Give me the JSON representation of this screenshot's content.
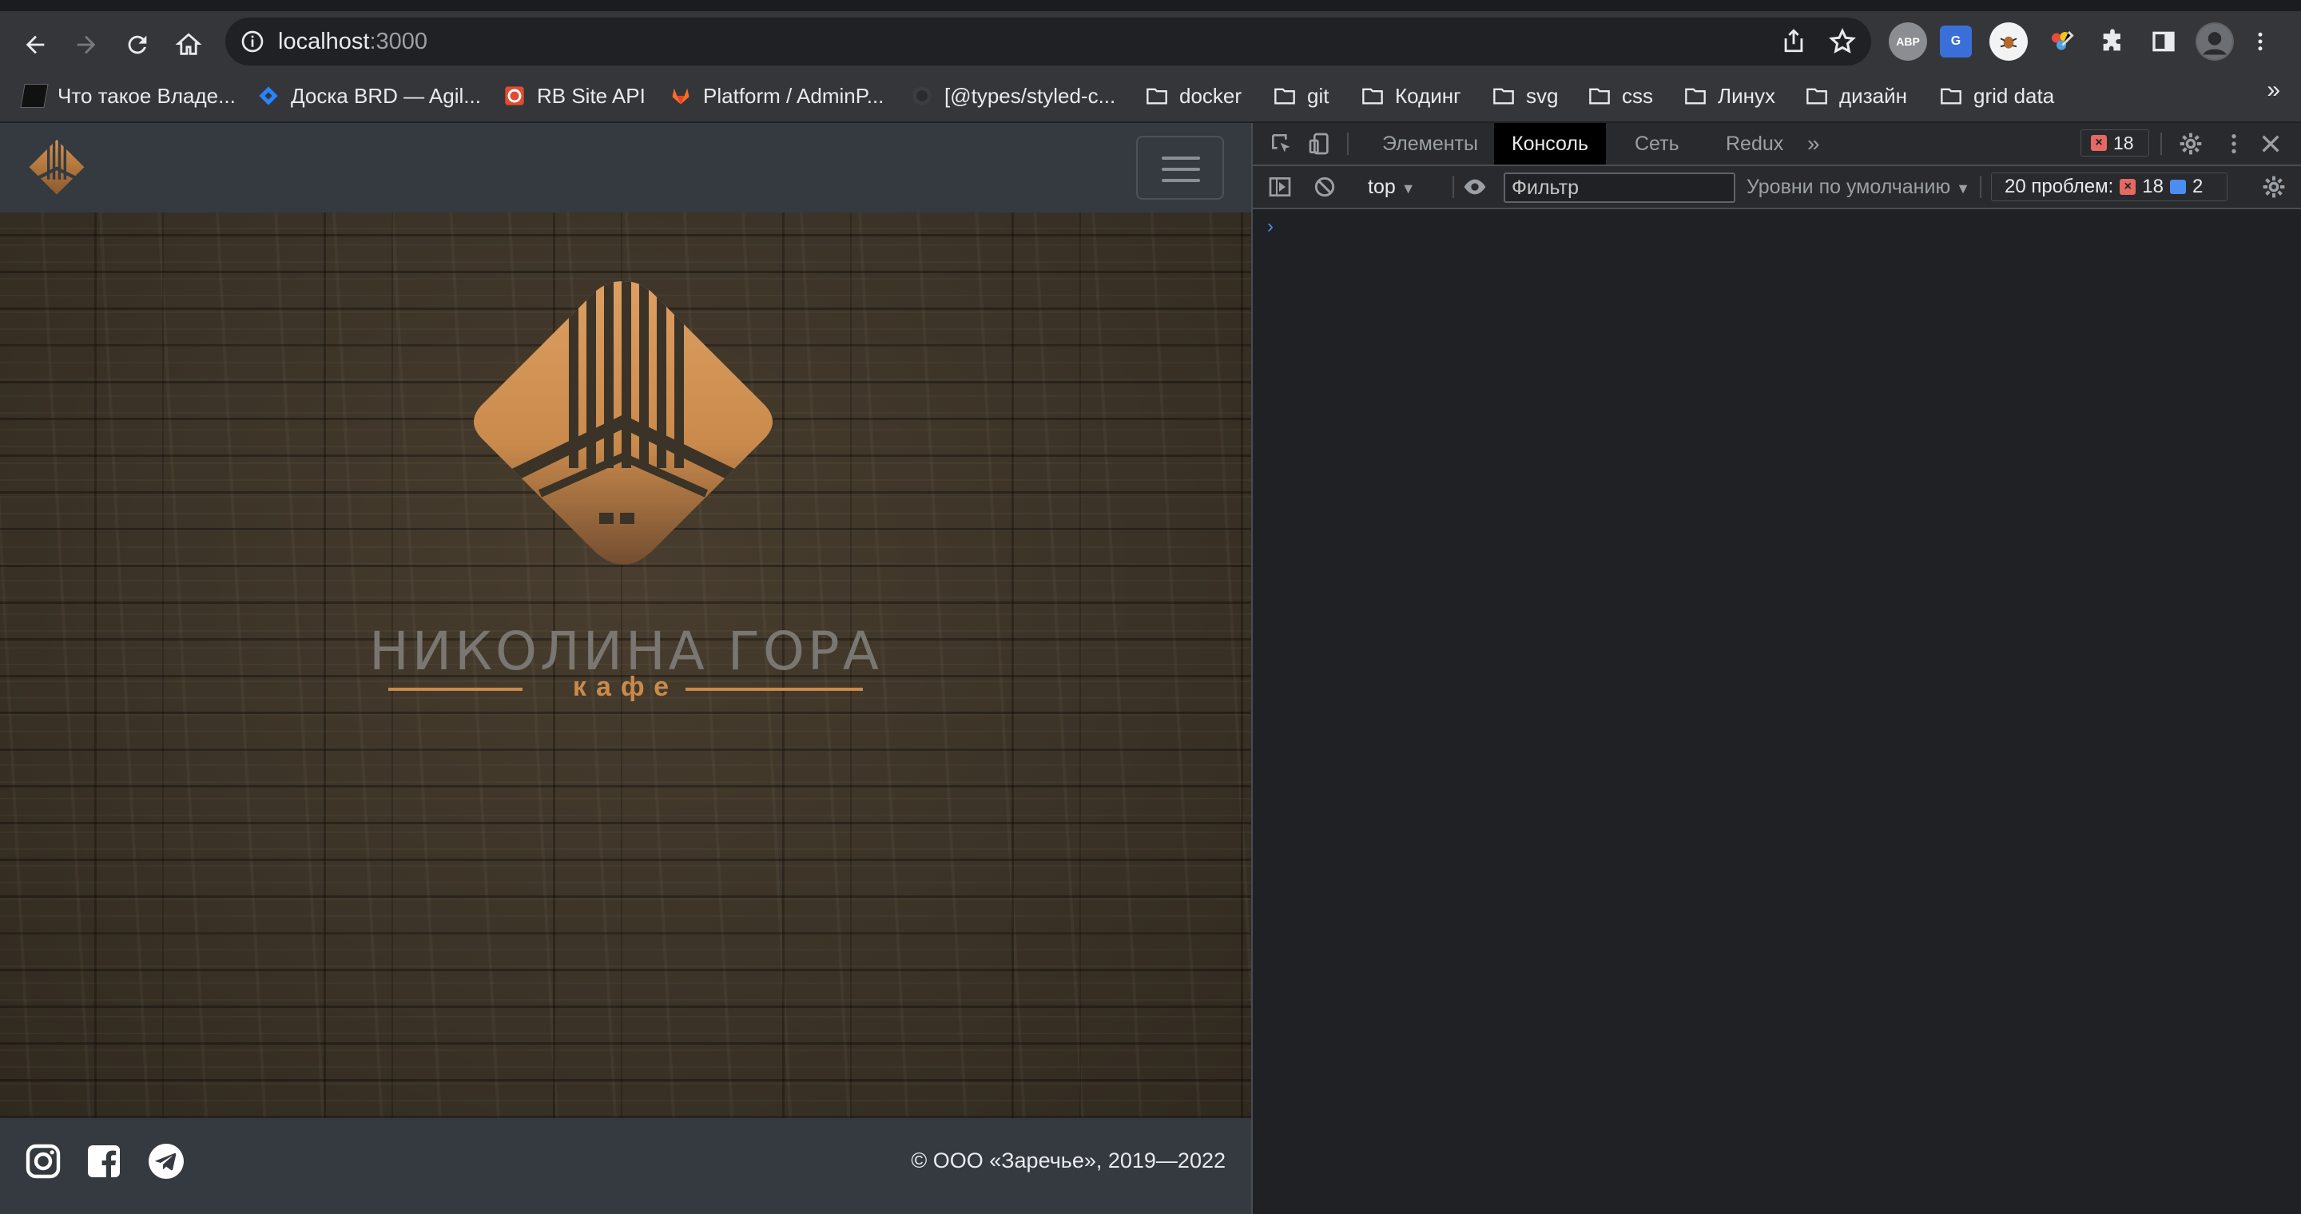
{
  "browser": {
    "url_host": "localhost",
    "url_port": ":3000",
    "extensions": [
      "ABP",
      "G"
    ],
    "bookmarks": [
      {
        "label": "Что такое Владе...",
        "icon": "dark-page-icon"
      },
      {
        "label": "Доска BRD — Agil...",
        "icon": "jira-icon"
      },
      {
        "label": "RB Site API",
        "icon": "red-api-icon"
      },
      {
        "label": "Platform / AdminP...",
        "icon": "gitlab-icon"
      },
      {
        "label": "[@types/styled-c...",
        "icon": "github-icon"
      },
      {
        "label": "docker",
        "icon": "folder-icon"
      },
      {
        "label": "git",
        "icon": "folder-icon"
      },
      {
        "label": "Кодинг",
        "icon": "folder-icon"
      },
      {
        "label": "svg",
        "icon": "folder-icon"
      },
      {
        "label": "css",
        "icon": "folder-icon"
      },
      {
        "label": "Линух",
        "icon": "folder-icon"
      },
      {
        "label": "дизайн",
        "icon": "folder-icon"
      },
      {
        "label": "grid data",
        "icon": "folder-icon"
      }
    ],
    "more_label": "»"
  },
  "page": {
    "brand_name": "НИКОЛИНА ГОРА",
    "brand_sub": "кафе",
    "copyright": "© ООО «Заречье», 2019—2022",
    "colors": {
      "accent": "#c98a4c",
      "navbar": "#343a40"
    }
  },
  "devtools": {
    "tabs": [
      {
        "label": "Элементы",
        "active": false
      },
      {
        "label": "Консоль",
        "active": true
      },
      {
        "label": "Сеть",
        "active": false
      },
      {
        "label": "Redux",
        "active": false
      }
    ],
    "more_tabs": "»",
    "error_count": "18",
    "context": "top",
    "filter_placeholder": "Фильтр",
    "levels_label": "Уровни по умолчанию",
    "issues_label": "20 проблем:",
    "issues_errors": "18",
    "issues_messages": "2",
    "prompt": "›"
  }
}
